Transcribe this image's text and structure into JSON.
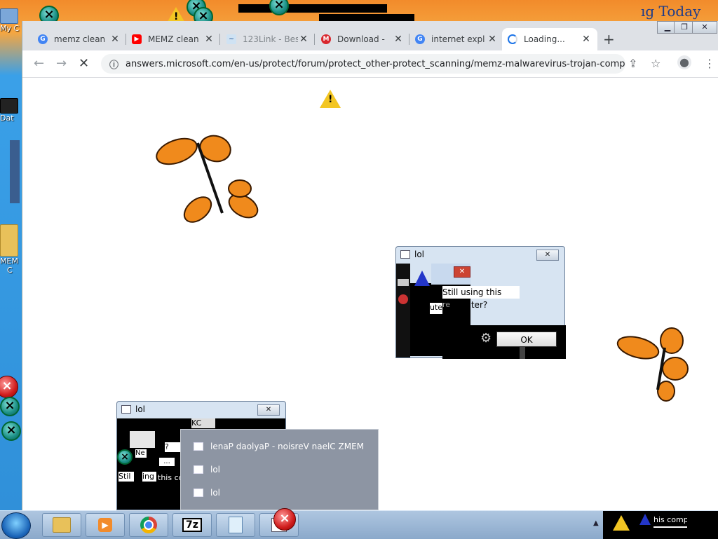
{
  "desktop": {
    "icons": [
      {
        "label": "My C"
      },
      {
        "label": "Dat"
      },
      {
        "label": "MEM"
      },
      {
        "label": "C"
      }
    ],
    "top_banner_text": "ıg Today ..."
  },
  "browser": {
    "tabs": [
      {
        "label": "memz clean",
        "favicon": "google-icon",
        "color": "#4285f4"
      },
      {
        "label": "MEMZ clean",
        "favicon": "youtube-icon",
        "color": "#ff0000"
      },
      {
        "label": "123Link - Bes",
        "favicon": "link-icon",
        "color": "#6fa8dc"
      },
      {
        "label": "Download - ",
        "favicon": "mega-icon",
        "color": "#d9272e"
      },
      {
        "label": "internet expl",
        "favicon": "google-icon",
        "color": "#4285f4"
      },
      {
        "label": "Loading...",
        "favicon": "spinner-icon",
        "color": "#1a73e8"
      }
    ],
    "new_tab_label": "+",
    "url": "answers.microsoft.com/en-us/protect/forum/protect_other-protect_scanning/memz-malwarevirus-trojan-comple...",
    "window_controls": [
      "minimize",
      "maximize",
      "close"
    ]
  },
  "dialog_main": {
    "title": "lol",
    "message": "Still using this computer?",
    "fragment": "ute",
    "fragment2": "re",
    "ok_label": "OK"
  },
  "dialog_small": {
    "title": "lol",
    "fragments": [
      "KC",
      "?retu",
      "Ne",
      "...",
      "Stil",
      "ing",
      "this co"
    ]
  },
  "jump_list": {
    "items": [
      {
        "label": "lenaP daolyaP - noisreV naelC ZMEM"
      },
      {
        "label": "lol"
      },
      {
        "label": "lol"
      }
    ]
  },
  "taskbar": {
    "apps": [
      "explorer",
      "media-player",
      "chrome",
      "7z",
      "notepad",
      "lol"
    ],
    "seven_zip_label": "7z",
    "tray_arrow": "▲",
    "tray_text": "his comp"
  }
}
